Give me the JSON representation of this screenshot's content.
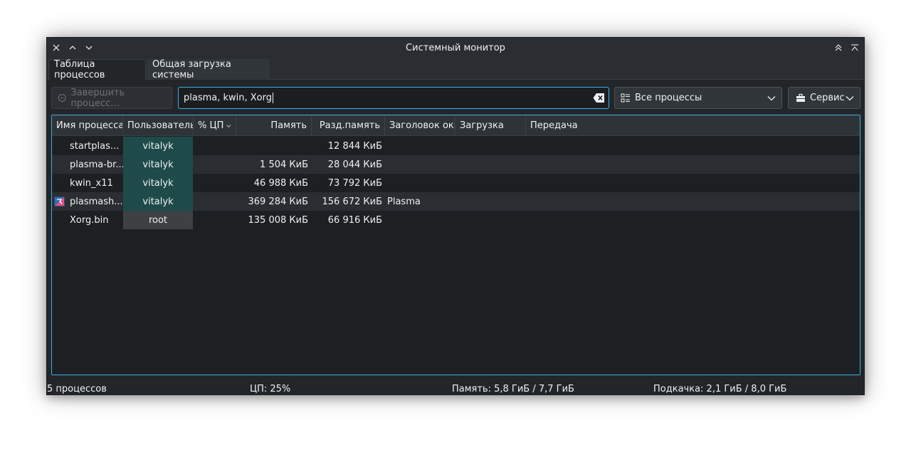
{
  "window": {
    "title": "Системный монитор"
  },
  "tabs": [
    {
      "label": "Таблица процессов",
      "active": true
    },
    {
      "label": "Общая загрузка системы",
      "active": false
    }
  ],
  "toolbar": {
    "kill_label": "Завершить процесс...",
    "search_value": "plasma, kwin, Xorg",
    "filter_selected": "Все процессы",
    "tools_label": "Сервис"
  },
  "table": {
    "columns": [
      "Имя процесса",
      "Пользователь",
      "% ЦП",
      "Память",
      "Разд.память",
      "Заголовок окна",
      "Загрузка",
      "Передача"
    ],
    "sorted_column": "% ЦП",
    "rows": [
      {
        "name": "startplas...",
        "user": "vitalyk",
        "cpu": "",
        "mem": "",
        "shared": "12 844 КиБ",
        "title": "",
        "has_icon": false
      },
      {
        "name": "plasma-br...",
        "user": "vitalyk",
        "cpu": "",
        "mem": "1 504 КиБ",
        "shared": "28 044 КиБ",
        "title": "",
        "has_icon": false
      },
      {
        "name": "kwin_x11",
        "user": "vitalyk",
        "cpu": "",
        "mem": "46 988 КиБ",
        "shared": "73 792 КиБ",
        "title": "",
        "has_icon": false
      },
      {
        "name": "plasmash...",
        "user": "vitalyk",
        "cpu": "",
        "mem": "369 284 КиБ",
        "shared": "156 672 КиБ",
        "title": "Plasma",
        "has_icon": true
      },
      {
        "name": "Xorg.bin",
        "user": "root",
        "cpu": "",
        "mem": "135 008 КиБ",
        "shared": "66 916 КиБ",
        "title": "",
        "has_icon": false
      }
    ]
  },
  "statusbar": {
    "processes": "5 процессов",
    "cpu": "ЦП: 25%",
    "memory": "Память: 5,8 ГиБ / 7,7 ГиБ",
    "swap": "Подкачка: 2,1 ГиБ / 8,0 ГиБ"
  },
  "colors": {
    "accent": "#3daee9",
    "window_bg": "#232629",
    "user_highlight": "#1e4a4a",
    "root_highlight": "#3d4144"
  },
  "icons": {
    "close": "close-icon",
    "minimize": "chevron-up-icon",
    "maximize": "chevron-down-icon",
    "keep_above": "double-chevron-up-icon",
    "shade": "shade-icon",
    "kill": "kill-process-icon",
    "clear": "clear-text-icon",
    "filter": "process-list-icon",
    "tools": "toolbox-icon",
    "sort": "sort-descending-icon",
    "plasma_process": "plasma-app-icon"
  }
}
